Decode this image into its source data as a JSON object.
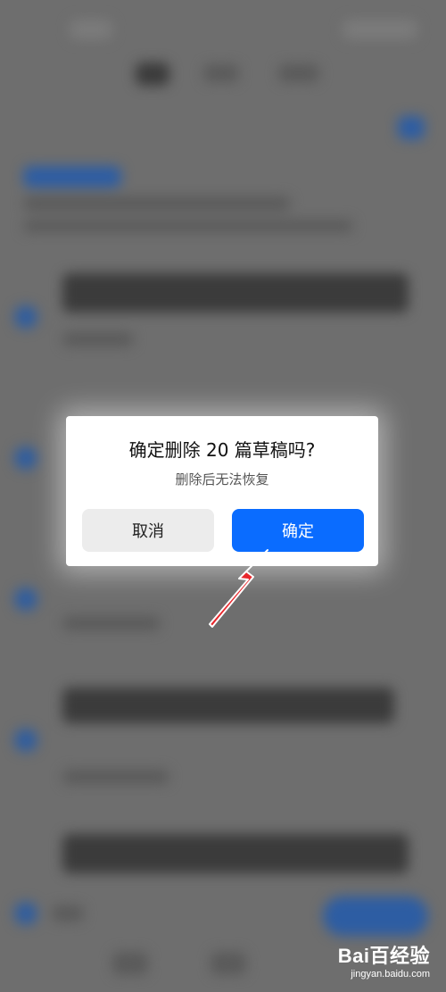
{
  "dialog": {
    "title": "确定删除 20 篇草稿吗?",
    "subtitle": "删除后无法恢复",
    "cancel_label": "取消",
    "confirm_label": "确定"
  },
  "watermark": {
    "logo": "Bai百经验",
    "url": "jingyan.baidu.com"
  },
  "colors": {
    "confirm_button": "#0a6cff",
    "cancel_button": "#ececec",
    "arrow": "#e8262b",
    "overlay": "#6e6e6e"
  }
}
